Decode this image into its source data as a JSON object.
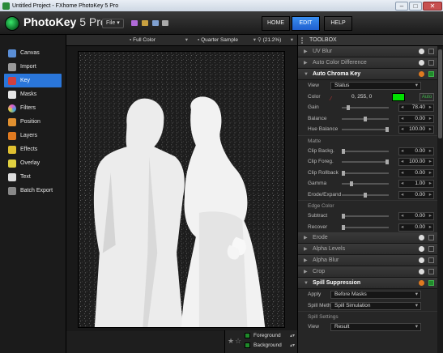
{
  "window": {
    "title": "Untitled Project - FXhome PhotoKey 5 Pro",
    "minimize": "–",
    "maximize": "□",
    "close": "✕"
  },
  "app": {
    "logo_main": "PhotoKey",
    "logo_version": " 5 Pro",
    "file_menu": "File ▾"
  },
  "nav": {
    "home": "HOME",
    "edit": "EDIT",
    "help": "HELP"
  },
  "sidebar": {
    "items": [
      {
        "label": "Canvas",
        "icon": "canvas-icon",
        "color": "#5a8ed6"
      },
      {
        "label": "Import",
        "icon": "import-icon",
        "color": "#9a9a9a"
      },
      {
        "label": "Key",
        "icon": "key-icon",
        "color": "#d04040"
      },
      {
        "label": "Masks",
        "icon": "masks-icon",
        "color": "#e6e6e6"
      },
      {
        "label": "Filters",
        "icon": "filters-icon",
        "color": "#e05ad0"
      },
      {
        "label": "Position",
        "icon": "position-icon",
        "color": "#e09030"
      },
      {
        "label": "Layers",
        "icon": "layers-icon",
        "color": "#e07a20"
      },
      {
        "label": "Effects",
        "icon": "effects-icon",
        "color": "#e0c030"
      },
      {
        "label": "Overlay",
        "icon": "overlay-icon",
        "color": "#e0d040"
      },
      {
        "label": "Text",
        "icon": "text-icon",
        "color": "#dddddd"
      },
      {
        "label": "Batch Export",
        "icon": "batch-export-icon",
        "color": "#888888"
      }
    ],
    "active_index": 2
  },
  "canvas_toolbar": {
    "view_mode": "Full Color",
    "sample": "Quarter Sample",
    "zoom": "(21.2%)"
  },
  "layers": {
    "foreground": "Foreground",
    "background": "Background"
  },
  "toolbox": {
    "title": "TOOLBOX",
    "collapsed_top": [
      "UV Blur",
      "Auto Color Difference"
    ],
    "key_section": "Auto Chroma Key",
    "view_label": "View",
    "view_value": "Status",
    "color_label": "Color",
    "color_value": "0, 255, 0",
    "auto_label": "Auto",
    "key_color": "#00e000",
    "params_top": [
      {
        "label": "Gain",
        "value": "78.40"
      },
      {
        "label": "Balance",
        "value": "0.00"
      },
      {
        "label": "Hue Balance",
        "value": "100.00"
      }
    ],
    "matte_label": "Matte",
    "params_matte": [
      {
        "label": "Clip Backg.",
        "value": "0.00"
      },
      {
        "label": "Clip Foreg.",
        "value": "100.00"
      },
      {
        "label": "Clip Rollback",
        "value": "0.00"
      },
      {
        "label": "Gamma",
        "value": "1.00"
      },
      {
        "label": "Erode/Expand",
        "value": "0.00"
      }
    ],
    "edge_label": "Edge Color",
    "params_edge": [
      {
        "label": "Subtract",
        "value": "0.00"
      },
      {
        "label": "Recover",
        "value": "0.00"
      }
    ],
    "collapsed_mid": [
      "Erode",
      "Alpha Levels",
      "Alpha Blur",
      "Crop"
    ],
    "spill_section": "Spill Suppression",
    "apply_label": "Apply",
    "apply_value": "Before Masks",
    "spill_method_label": "Spill Method",
    "spill_method_value": "Spill Simulation",
    "spill_settings_label": "Spill Settings",
    "spill_view_label": "View",
    "spill_view_value": "Result"
  }
}
